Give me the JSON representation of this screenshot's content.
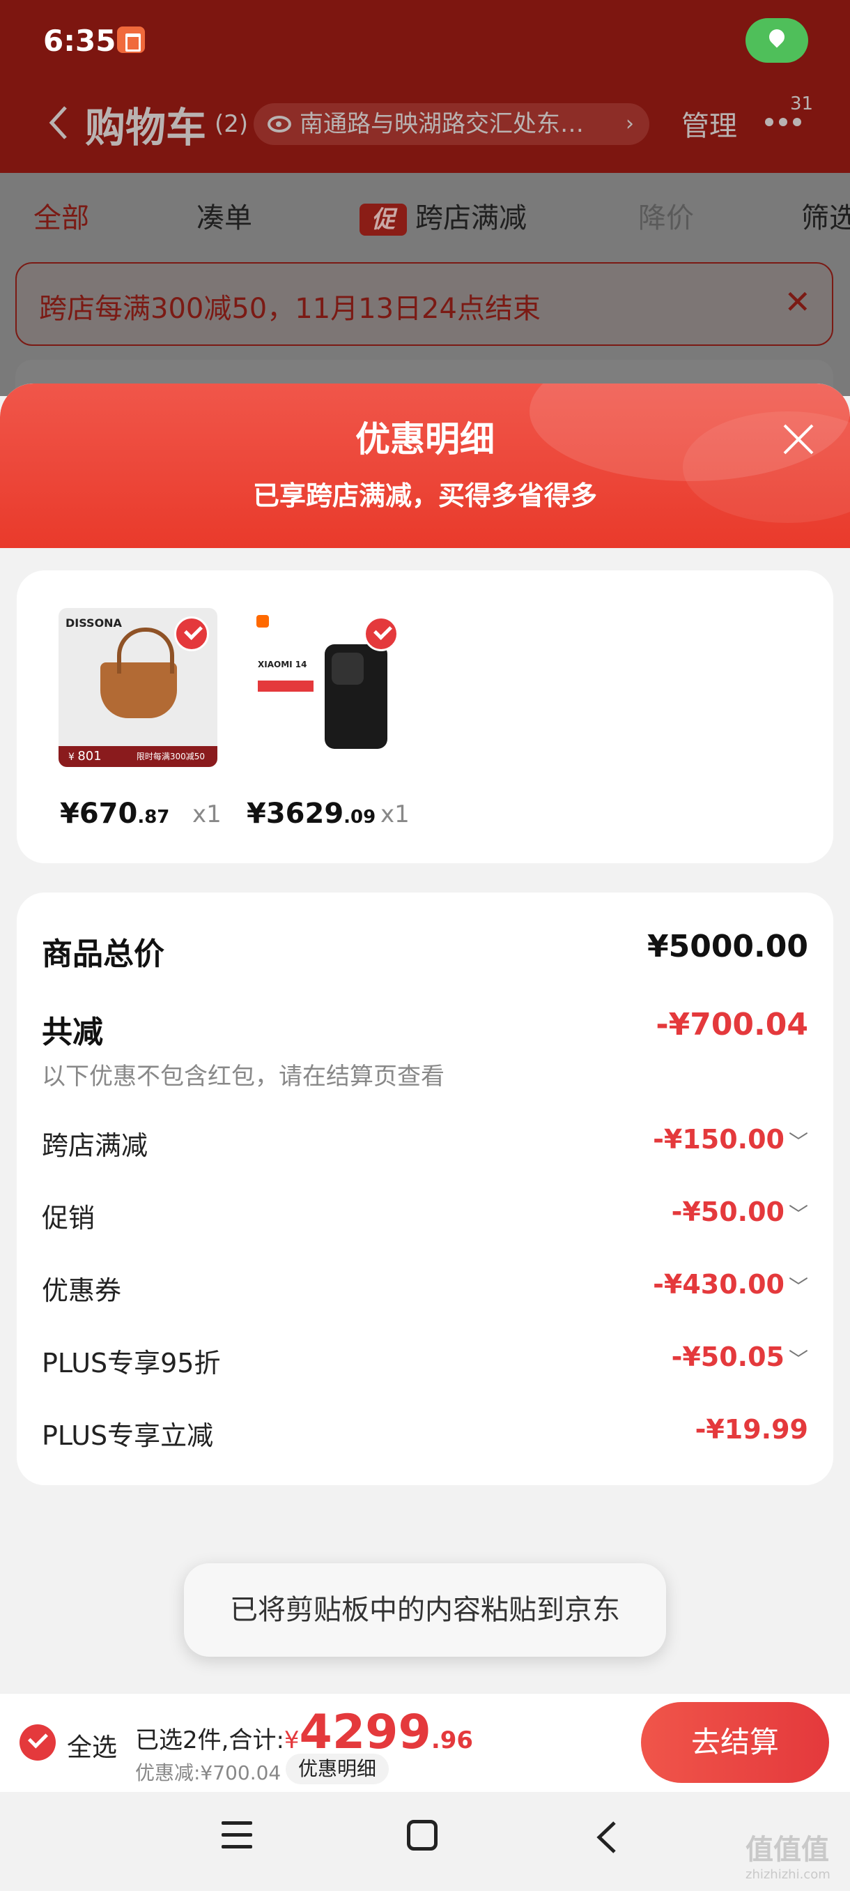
{
  "status": {
    "time": "6:35"
  },
  "header": {
    "title": "购物车",
    "count": "(2)",
    "address": "南通路与映湖路交汇处东…",
    "manage": "管理",
    "more_badge": "31"
  },
  "tabs": [
    {
      "label": "全部"
    },
    {
      "label": "凑单"
    },
    {
      "tag": "促",
      "label": "跨店满减"
    },
    {
      "label": "降价"
    },
    {
      "label": "筛选"
    }
  ],
  "notice": {
    "text": "跨店每满300减50，11月13日24点结束",
    "close": "✕"
  },
  "sheet": {
    "title": "优惠明细",
    "subtitle": "已享跨店满减，买得多省得多"
  },
  "products": [
    {
      "brand": "DISSONA",
      "strip_price": "801",
      "strip_promo": "限时每满300减50",
      "price_int": "¥670",
      "price_dec": ".87",
      "qty": "x1"
    },
    {
      "brand": "XIAOMI 14",
      "price_int": "¥3629",
      "price_dec": ".09",
      "qty": "x1"
    }
  ],
  "summary": {
    "total_label": "商品总价",
    "total_value": "¥5000.00",
    "reduce_label": "共减",
    "reduce_value": "-¥700.04",
    "note": "以下优惠不包含红包，请在结算页查看",
    "items": [
      {
        "label": "跨店满减",
        "value": "-¥150.00",
        "chev": "﹀"
      },
      {
        "label": "促销",
        "value": "-¥50.00",
        "chev": "﹀"
      },
      {
        "label": "优惠券",
        "value": "-¥430.00",
        "chev": "﹀"
      },
      {
        "label": "PLUS专享95折",
        "value": "-¥50.05",
        "chev": "﹀"
      },
      {
        "label": "PLUS专享立减",
        "value": "-¥19.99",
        "chev": ""
      }
    ]
  },
  "toast": "已将剪贴板中的内容粘贴到京东",
  "bottom": {
    "select_all": "全选",
    "selected_text": "已选2件,合计:",
    "currency": "¥",
    "total_int": "4299",
    "total_dec": ".96",
    "discount_text": "优惠减:¥700.04",
    "detail_button": "优惠明细",
    "checkout": "去结算"
  },
  "watermark": {
    "main": "值值值",
    "sub": "zhizhizhi.com"
  },
  "colors": {
    "accent": "#e4393c",
    "header_dim": "#7d1610"
  }
}
